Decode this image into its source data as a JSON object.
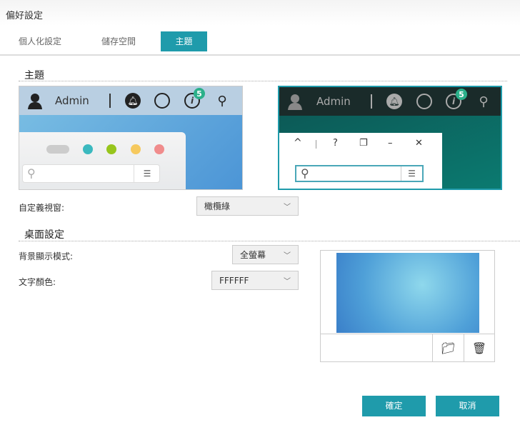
{
  "window": {
    "title": "偏好設定"
  },
  "tabs": [
    {
      "label": "個人化設定"
    },
    {
      "label": "儲存空間"
    },
    {
      "label": "主題",
      "active": true
    }
  ],
  "theme_section": {
    "title": "主題",
    "previews": [
      {
        "user": "Admin",
        "badge": "5",
        "style": "light"
      },
      {
        "user": "Admin",
        "badge": "5",
        "style": "dark"
      }
    ],
    "custom_window_label": "自定義視窗:",
    "custom_window_value": "橄欖綠"
  },
  "desktop_section": {
    "title": "桌面設定",
    "bg_mode_label": "背景顯示模式:",
    "bg_mode_value": "全螢幕",
    "text_color_label": "文字顏色:",
    "text_color_value": "FFFFFF"
  },
  "buttons": {
    "ok": "確定",
    "cancel": "取消"
  },
  "colors": {
    "accent": "#1f9bab"
  }
}
